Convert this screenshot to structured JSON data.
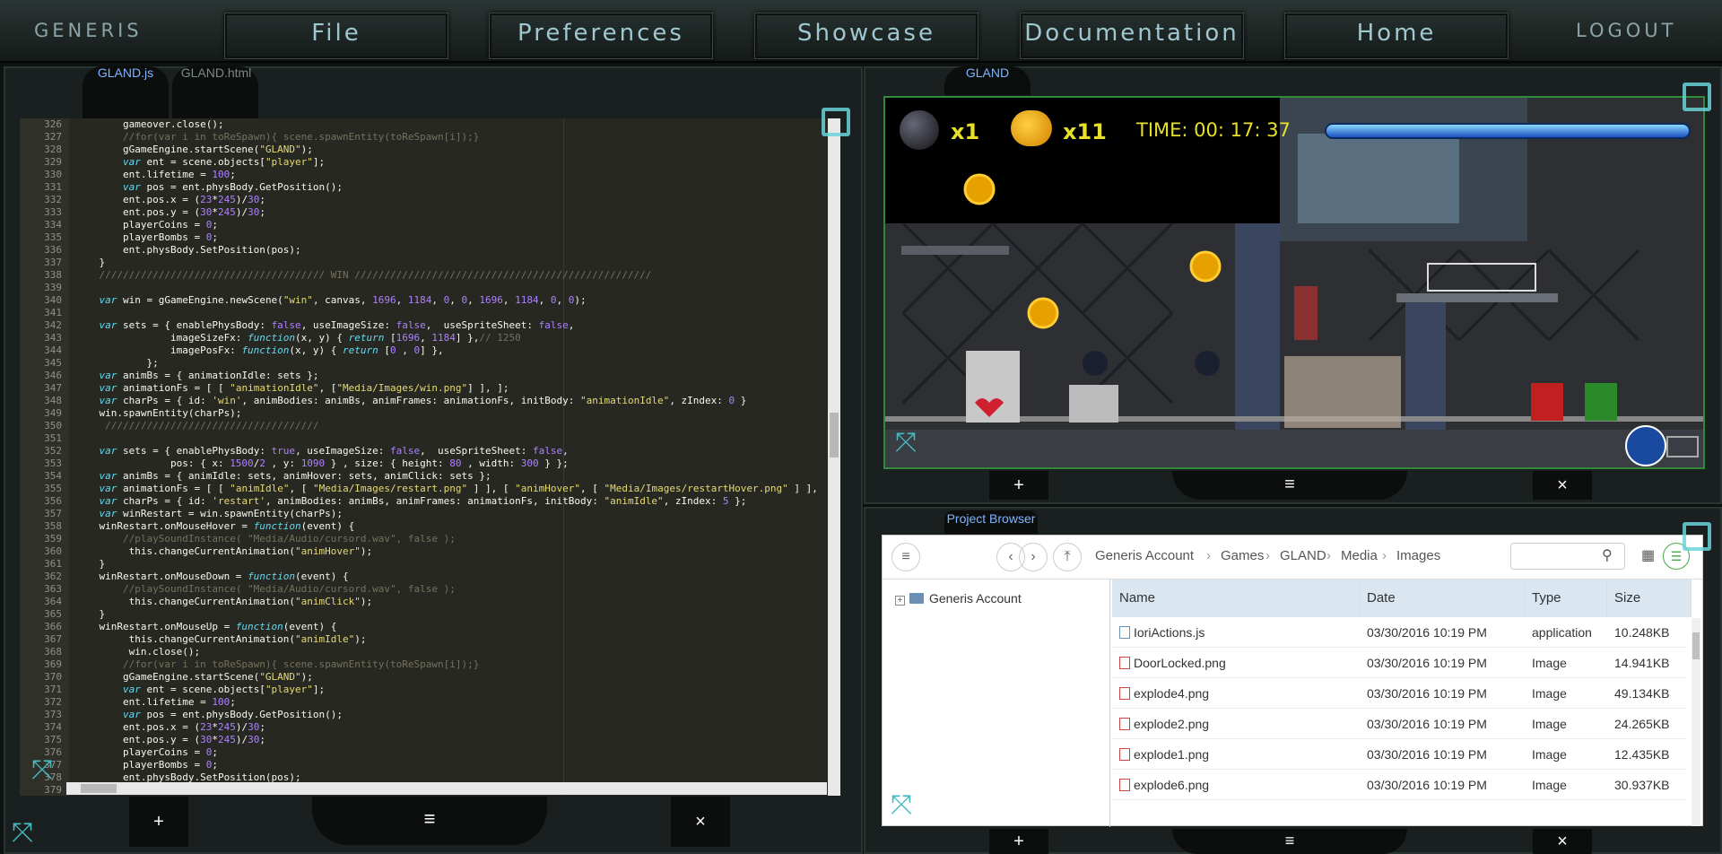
{
  "nav": {
    "brand": "GENERIS",
    "buttons": [
      "File",
      "Preferences",
      "Showcase",
      "Documentation",
      "Home"
    ],
    "logout": "LOGOUT"
  },
  "editor_panel": {
    "tabs": [
      "GLAND.js",
      "GLAND.html"
    ],
    "plus": "+",
    "menu": "≡",
    "close": "×"
  },
  "code_lines": [
    {
      "n": "326",
      "t": "        gameover.close();"
    },
    {
      "n": "327",
      "t": "        //for(var i in toReSpawn){ scene.spawnEntity(toReSpawn[i]);}"
    },
    {
      "n": "328",
      "t": "        gGameEngine.startScene(\"GLAND\");"
    },
    {
      "n": "329",
      "t": "        var ent = scene.objects[\"player\"];"
    },
    {
      "n": "330",
      "t": "        ent.lifetime = 100;"
    },
    {
      "n": "331",
      "t": "        var pos = ent.physBody.GetPosition();"
    },
    {
      "n": "332",
      "t": "        ent.pos.x = (23*245)/30;"
    },
    {
      "n": "333",
      "t": "        ent.pos.y = (30*245)/30;"
    },
    {
      "n": "334",
      "t": "        playerCoins = 0;"
    },
    {
      "n": "335",
      "t": "        playerBombs = 0;"
    },
    {
      "n": "336",
      "t": "        ent.physBody.SetPosition(pos);"
    },
    {
      "n": "337",
      "t": "    }"
    },
    {
      "n": "338",
      "t": "    ////////////////////////////////////// WIN //////////////////////////////////////////////////"
    },
    {
      "n": "339",
      "t": ""
    },
    {
      "n": "340",
      "t": "    var win = gGameEngine.newScene(\"win\", canvas, 1696, 1184, 0, 0, 1696, 1184, 0, 0);"
    },
    {
      "n": "341",
      "t": ""
    },
    {
      "n": "342",
      "t": "    var sets = { enablePhysBody: false, useImageSize: false,  useSpriteSheet: false,"
    },
    {
      "n": "343",
      "t": "                imageSizeFx: function(x, y) { return [1696, 1184] },// 1250"
    },
    {
      "n": "344",
      "t": "                imagePosFx: function(x, y) { return [0 , 0] },"
    },
    {
      "n": "345",
      "t": "            };"
    },
    {
      "n": "346",
      "t": "    var animBs = { animationIdle: sets };"
    },
    {
      "n": "347",
      "t": "    var animationFs = [ [ \"animationIdle\", [\"Media/Images/win.png\"] ], ];"
    },
    {
      "n": "348",
      "t": "    var charPs = { id: 'win', animBodies: animBs, animFrames: animationFs, initBody: \"animationIdle\", zIndex: 0 }"
    },
    {
      "n": "349",
      "t": "    win.spawnEntity(charPs);"
    },
    {
      "n": "350",
      "t": "     ////////////////////////////////////"
    },
    {
      "n": "351",
      "t": ""
    },
    {
      "n": "352",
      "t": "    var sets = { enablePhysBody: true, useImageSize: false,  useSpriteSheet: false,"
    },
    {
      "n": "353",
      "t": "                pos: { x: 1500/2 , y: 1090 } , size: { height: 80 , width: 300 } };"
    },
    {
      "n": "354",
      "t": "    var animBs = { animIdle: sets, animHover: sets, animClick: sets };"
    },
    {
      "n": "355",
      "t": "    var animationFs = [ [ \"animIdle\", [ \"Media/Images/restart.png\" ] ], [ \"animHover\", [ \"Media/Images/restartHover.png\" ] ], ["
    },
    {
      "n": "356",
      "t": "    var charPs = { id: 'restart', animBodies: animBs, animFrames: animationFs, initBody: \"animIdle\", zIndex: 5 };"
    },
    {
      "n": "357",
      "t": "    var winRestart = win.spawnEntity(charPs);"
    },
    {
      "n": "358",
      "t": "    winRestart.onMouseHover = function(event) {"
    },
    {
      "n": "359",
      "t": "        //playSoundInstance( \"Media/Audio/cursord.wav\", false );"
    },
    {
      "n": "360",
      "t": "         this.changeCurrentAnimation(\"animHover\");"
    },
    {
      "n": "361",
      "t": "    }"
    },
    {
      "n": "362",
      "t": "    winRestart.onMouseDown = function(event) {"
    },
    {
      "n": "363",
      "t": "        //playSoundInstance( \"Media/Audio/cursord.wav\", false );"
    },
    {
      "n": "364",
      "t": "         this.changeCurrentAnimation(\"animClick\");"
    },
    {
      "n": "365",
      "t": "    }"
    },
    {
      "n": "366",
      "t": "    winRestart.onMouseUp = function(event) {"
    },
    {
      "n": "367",
      "t": "         this.changeCurrentAnimation(\"animIdle\");"
    },
    {
      "n": "368",
      "t": "         win.close();"
    },
    {
      "n": "369",
      "t": "        //for(var i in toReSpawn){ scene.spawnEntity(toReSpawn[i]);}"
    },
    {
      "n": "370",
      "t": "        gGameEngine.startScene(\"GLAND\");"
    },
    {
      "n": "371",
      "t": "        var ent = scene.objects[\"player\"];"
    },
    {
      "n": "372",
      "t": "        ent.lifetime = 100;"
    },
    {
      "n": "373",
      "t": "        var pos = ent.physBody.GetPosition();"
    },
    {
      "n": "374",
      "t": "        ent.pos.x = (23*245)/30;"
    },
    {
      "n": "375",
      "t": "        ent.pos.y = (30*245)/30;"
    },
    {
      "n": "376",
      "t": "        playerCoins = 0;"
    },
    {
      "n": "377",
      "t": "        playerBombs = 0;"
    },
    {
      "n": "378",
      "t": "        ent.physBody.SetPosition(pos);"
    },
    {
      "n": "379",
      "t": ""
    }
  ],
  "game_panel": {
    "tab": "GLAND",
    "bombs": "x1",
    "coins": "x11",
    "time": "TIME: 00: 17: 37",
    "plus": "+",
    "menu": "≡",
    "close": "×"
  },
  "browser": {
    "tab": "Project Browser",
    "breadcrumb": [
      "Generis Account",
      "Games",
      "GLAND",
      "Media",
      "Images"
    ],
    "tree_root": "Generis Account",
    "columns": [
      "Name",
      "Date",
      "Type",
      "Size"
    ],
    "rows": [
      {
        "name": "IoriActions.js",
        "date": "03/30/2016 10:19 PM",
        "type": "application",
        "size": "10.248KB"
      },
      {
        "name": "DoorLocked.png",
        "date": "03/30/2016 10:19 PM",
        "type": "Image",
        "size": "14.941KB"
      },
      {
        "name": "explode4.png",
        "date": "03/30/2016 10:19 PM",
        "type": "Image",
        "size": "49.134KB"
      },
      {
        "name": "explode2.png",
        "date": "03/30/2016 10:19 PM",
        "type": "Image",
        "size": "24.265KB"
      },
      {
        "name": "explode1.png",
        "date": "03/30/2016 10:19 PM",
        "type": "Image",
        "size": "12.435KB"
      },
      {
        "name": "explode6.png",
        "date": "03/30/2016 10:19 PM",
        "type": "Image",
        "size": "30.937KB"
      }
    ],
    "plus": "+",
    "menu": "≡",
    "close": "×"
  },
  "colors": {
    "accent": "#6ad3d8",
    "hud": "#e7e02a",
    "link": "#7fb5ff"
  }
}
